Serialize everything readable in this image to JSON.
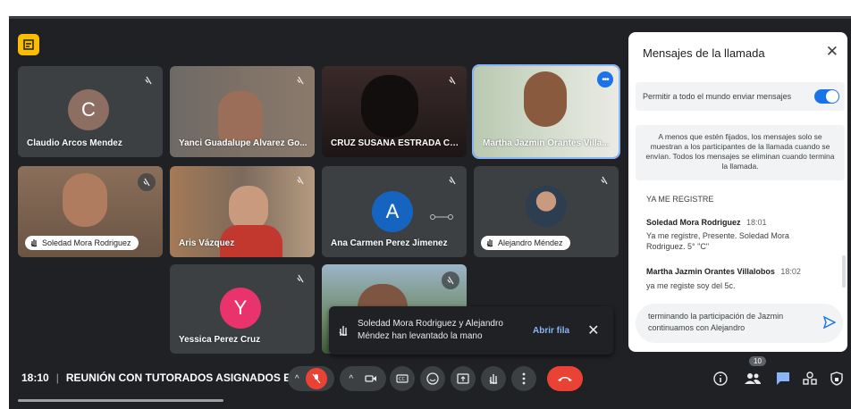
{
  "colors": {
    "bg": "#202124",
    "tile": "#3c4043",
    "red": "#ea4335",
    "blue": "#1a73e8",
    "accent": "#8ab4f8"
  },
  "tiles": [
    {
      "name": "Claudio Arcos Mendez",
      "initial": "C",
      "avatar_color": "#8d6e63",
      "muted": true
    },
    {
      "name": "Yanci Guadalupe Alvarez Go...",
      "muted": true
    },
    {
      "name": "CRUZ SUSANA ESTRADA CA...",
      "muted": true
    },
    {
      "name": "Martha Jazmin Orantes Villa...",
      "muted": false
    },
    {
      "name": "Soledad Mora Rodriguez",
      "muted": true
    },
    {
      "name": "Aris Vázquez",
      "muted": true
    },
    {
      "name": "Ana Carmen Perez Jimenez",
      "initial": "A",
      "avatar_color": "#1565c0",
      "muted": true
    },
    {
      "name": "Alejandro Méndez",
      "muted": true
    },
    {
      "name": "Yessica Perez Cruz",
      "initial": "Y",
      "avatar_color": "#e8336d",
      "muted": true
    },
    {
      "name": "",
      "muted": true
    }
  ],
  "toast": {
    "text": "Soledad Mora Rodriguez y Alejandro Méndez han levantado la mano",
    "action": "Abrir fila"
  },
  "bottom_bar": {
    "time": "18:10",
    "separator": "|",
    "meeting_title": "REUNIÓN CON TUTORADOS ASIGNADOS E...",
    "people_count": "10"
  },
  "panel": {
    "title": "Mensajes de la llamada",
    "toggle_label": "Permitir a todo el mundo enviar mensajes",
    "notice": "A menos que estén fijados, los mensajes solo se muestran a los participantes de la llamada cuando se envían. Todos los mensajes se eliminan cuando termina la llamada.",
    "messages": [
      {
        "text": "YA ME REGISTRE"
      },
      {
        "sender": "Soledad Mora Rodriguez",
        "time": "18:01",
        "text": "Ya me registre, Presente. Soledad Mora Rodriguez. 5° \"C\""
      },
      {
        "sender": "Martha Jazmin Orantes Villalobos",
        "time": "18:02",
        "text": "ya me registe soy del 5c."
      }
    ],
    "compose_line1": "terminando la participación de Jazmin",
    "compose_line2": "continuamos con Alejandro"
  }
}
